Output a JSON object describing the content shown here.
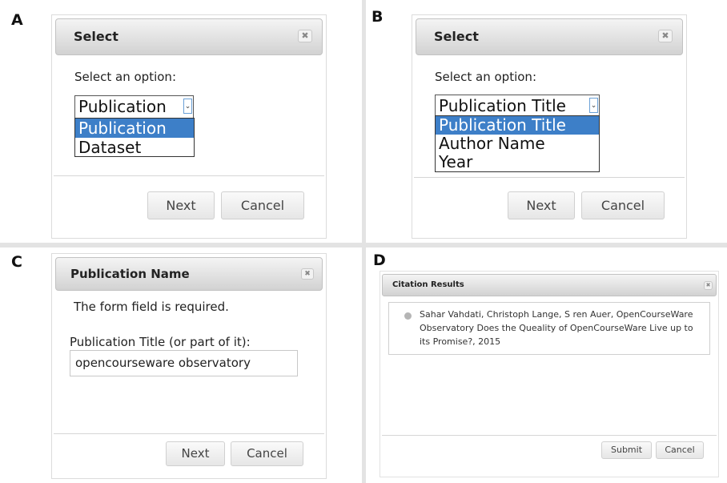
{
  "panels": {
    "a": {
      "label": "A",
      "title": "Select",
      "prompt": "Select an option:",
      "selected": "Publication",
      "options": [
        "Publication",
        "Dataset"
      ],
      "next": "Next",
      "cancel": "Cancel"
    },
    "b": {
      "label": "B",
      "title": "Select",
      "prompt": "Select an option:",
      "selected": "Publication Title",
      "options": [
        "Publication Title",
        "Author Name",
        "Year"
      ],
      "next": "Next",
      "cancel": "Cancel"
    },
    "c": {
      "label": "C",
      "title": "Publication Name",
      "required_msg": "The form field is required.",
      "field_label": "Publication Title (or part of it):",
      "field_value": "opencourseware observatory",
      "next": "Next",
      "cancel": "Cancel"
    },
    "d": {
      "label": "D",
      "title": "Citation Results",
      "result_lines": [
        "Sahar Vahdati, Christoph Lange, S ren Auer, OpenCourseWare",
        "Observatory Does the Queality of OpenCourseWare Live up to",
        "its Promise?, 2015"
      ],
      "submit": "Submit",
      "cancel": "Cancel"
    }
  },
  "icons": {
    "close": "close-icon",
    "dropdown": "chevron-down-icon",
    "bullet": "radio-bullet-icon"
  },
  "colors": {
    "selection": "#3d7fc8",
    "titlebar": "#d2d2d2"
  }
}
